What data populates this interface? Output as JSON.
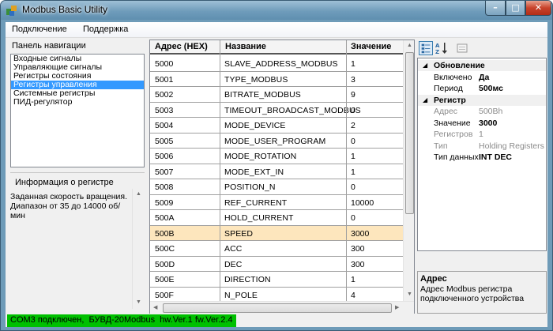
{
  "window": {
    "title": "Modbus Basic Utility"
  },
  "menu": {
    "items": [
      "Подключение",
      "Поддержка"
    ]
  },
  "nav": {
    "label": "Панель навигации",
    "items": [
      "Входные сигналы",
      "Управляющие сигналы",
      "Регистры состояния",
      "Регистры управления",
      "Системные регистры",
      "ПИД-регулятор"
    ],
    "selected_index": 3
  },
  "info": {
    "label": "Информация о регистре",
    "text": "Заданная скорость вращения. Диапазон от 35 до 14000 об/мин"
  },
  "grid": {
    "columns": [
      "Адрес (HEX)",
      "Название",
      "Значение"
    ],
    "rows": [
      [
        "5000",
        "SLAVE_ADDRESS_MODBUS",
        "1"
      ],
      [
        "5001",
        "TYPE_MODBUS",
        "3"
      ],
      [
        "5002",
        "BITRATE_MODBUS",
        "9"
      ],
      [
        "5003",
        "TIMEOUT_BROADCAST_MODBUS",
        "0"
      ],
      [
        "5004",
        "MODE_DEVICE",
        "2"
      ],
      [
        "5005",
        "MODE_USER_PROGRAM",
        "0"
      ],
      [
        "5006",
        "MODE_ROTATION",
        "1"
      ],
      [
        "5007",
        "MODE_EXT_IN",
        "1"
      ],
      [
        "5008",
        "POSITION_N",
        "0"
      ],
      [
        "5009",
        "REF_CURRENT",
        "10000"
      ],
      [
        "500A",
        "HOLD_CURRENT",
        "0"
      ],
      [
        "500B",
        "SPEED",
        "3000"
      ],
      [
        "500C",
        "ACC",
        "300"
      ],
      [
        "500D",
        "DEC",
        "300"
      ],
      [
        "500E",
        "DIRECTION",
        "1"
      ],
      [
        "500F",
        "N_POLE",
        "4"
      ]
    ],
    "selected_index": 11
  },
  "props": {
    "categories": [
      {
        "name": "Обновление",
        "rows": [
          {
            "key": "Включено",
            "value": "Да",
            "disabled": false
          },
          {
            "key": "Период",
            "value": "500мс",
            "disabled": false
          }
        ]
      },
      {
        "name": "Регистр",
        "rows": [
          {
            "key": "Адрес",
            "value": "500Bh",
            "disabled": true
          },
          {
            "key": "Значение",
            "value": "3000",
            "disabled": false
          },
          {
            "key": "Регистров",
            "value": "1",
            "disabled": true
          },
          {
            "key": "Тип",
            "value": "Holding Registers",
            "disabled": true
          },
          {
            "key": "Тип данных",
            "value": "INT DEC",
            "disabled": false
          }
        ]
      }
    ],
    "desc_title": "Адрес",
    "desc_text": "Адрес Modbus регистра подключенного устройства"
  },
  "status": {
    "text": "COM3 подключен,  БУВД-20Modbus  hw.Ver.1 fw.Ver.2.4"
  },
  "colors": {
    "selection": "#3399ff",
    "row_highlight": "#fde6bd",
    "status_ok": "#00c000"
  }
}
